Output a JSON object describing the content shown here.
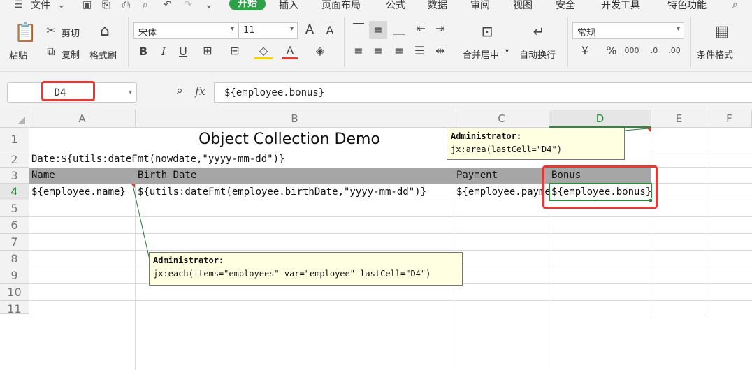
{
  "menu": {
    "file_label": "文件",
    "tabs": [
      "开始",
      "插入",
      "页面布局",
      "公式",
      "数据",
      "审阅",
      "视图",
      "安全",
      "开发工具",
      "特色功能"
    ],
    "active_tab": "开始"
  },
  "ribbon": {
    "paste": "粘贴",
    "cut": "剪切",
    "copy": "复制",
    "format_painter": "格式刷",
    "font_name": "宋体",
    "font_size": "11",
    "merge_center": "合并居中",
    "wrap_text": "自动换行",
    "number_format": "常规",
    "conditional_format": "条件格式"
  },
  "formula_bar": {
    "name_box": "D4",
    "fx": "fx",
    "formula": "${employee.bonus}"
  },
  "grid": {
    "columns": [
      "A",
      "B",
      "C",
      "D",
      "E",
      "F"
    ],
    "rows": [
      "1",
      "2",
      "3",
      "4",
      "5",
      "6",
      "7",
      "8",
      "9",
      "10",
      "11"
    ],
    "selected_column": "D",
    "selected_row": "4",
    "title": "Object Collection Demo",
    "date_row": "Date:${utils:dateFmt(nowdate,\"yyyy-mm-dd\")}",
    "headers": [
      "Name",
      "Birth Date",
      "Payment",
      "Bonus"
    ],
    "row4": [
      "${employee.name}",
      "${utils:dateFmt(employee.birthDate,\"yyyy-mm-dd\")}",
      "${employee.payment}",
      "${employee.bonus}"
    ]
  },
  "comments": [
    {
      "author": "Administrator:",
      "text": "jx:area(lastCell=\"D4\")"
    },
    {
      "author": "Administrator:",
      "text": "jx:each(items=\"employees\" var=\"employee\" lastCell=\"D4\")"
    }
  ],
  "accent_color": "#2ba245",
  "highlight_color": "#e53935"
}
